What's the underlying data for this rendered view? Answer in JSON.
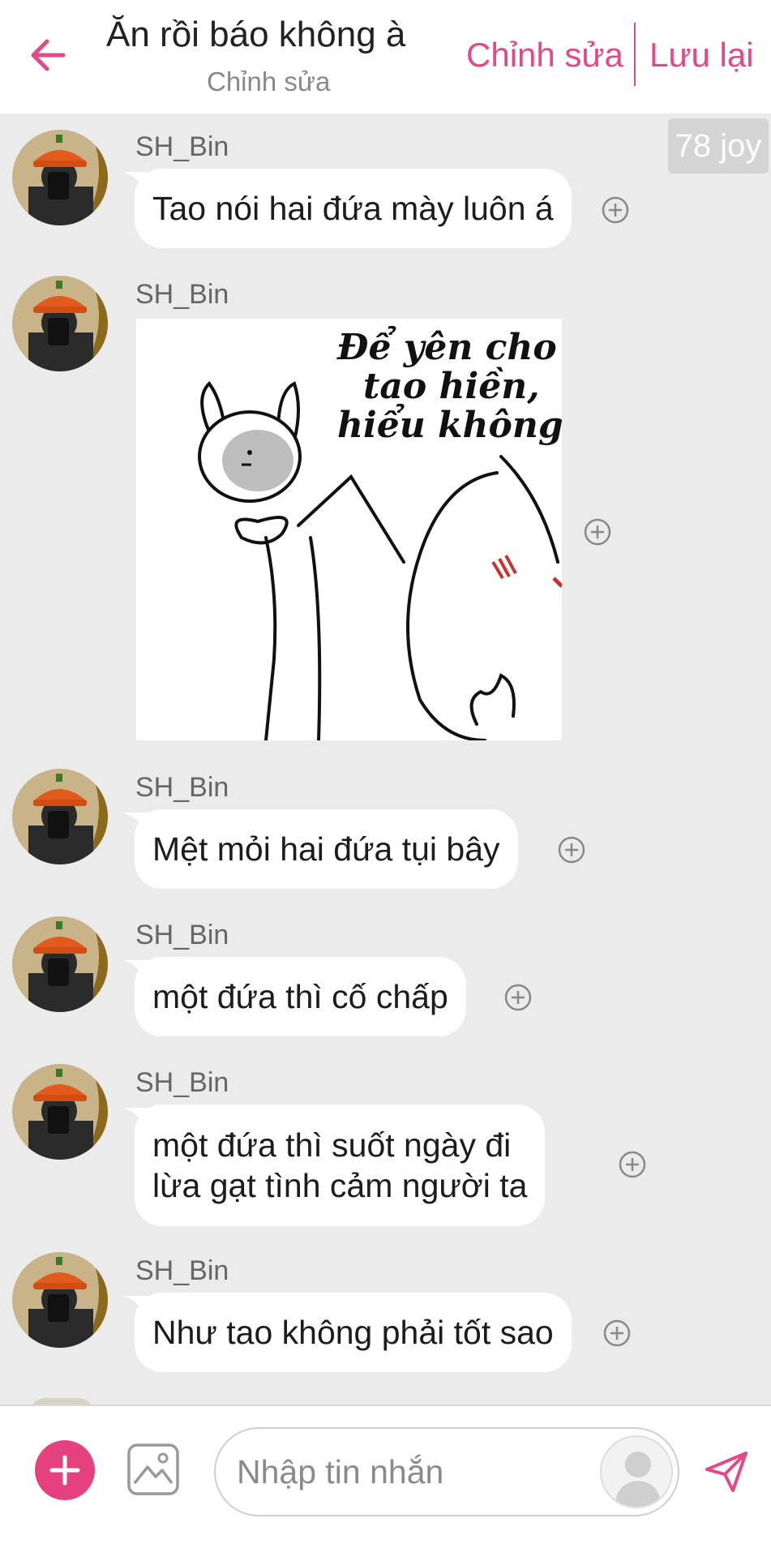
{
  "header": {
    "title": "Ăn rồi báo không à",
    "subtitle": "Chỉnh sửa",
    "edit_label": "Chỉnh sửa",
    "save_label": "Lưu lại"
  },
  "chat": {
    "joy_badge": "78 joy",
    "messages": [
      {
        "sender": "SH_Bin",
        "type": "text",
        "text": "Tao nói hai đứa mày luôn á"
      },
      {
        "sender": "SH_Bin",
        "type": "sticker",
        "sticker_text": [
          "Để yên cho",
          "tao hiền,",
          "hiểu không?"
        ]
      },
      {
        "sender": "SH_Bin",
        "type": "text",
        "text": "Mệt mỏi hai đứa tụi bây"
      },
      {
        "sender": "SH_Bin",
        "type": "text",
        "text": "một đứa thì cố chấp"
      },
      {
        "sender": "SH_Bin",
        "type": "text",
        "text_lines": [
          "một đứa thì suốt ngày đi",
          "lừa gạt tình cảm người ta"
        ]
      },
      {
        "sender": "SH_Bin",
        "type": "text",
        "text": "Như tao không phải tốt sao"
      }
    ]
  },
  "composer": {
    "placeholder": "Nhập tin nhắn"
  },
  "colors": {
    "accent": "#e44887",
    "plus_button": "#e6417f",
    "chat_background": "#ebebeb",
    "bubble": "#ffffff"
  },
  "icons": {
    "back": "arrow-left-icon",
    "react": "plus-circle-icon",
    "add": "plus-icon",
    "image": "image-icon",
    "user": "user-icon",
    "send": "send-icon"
  }
}
